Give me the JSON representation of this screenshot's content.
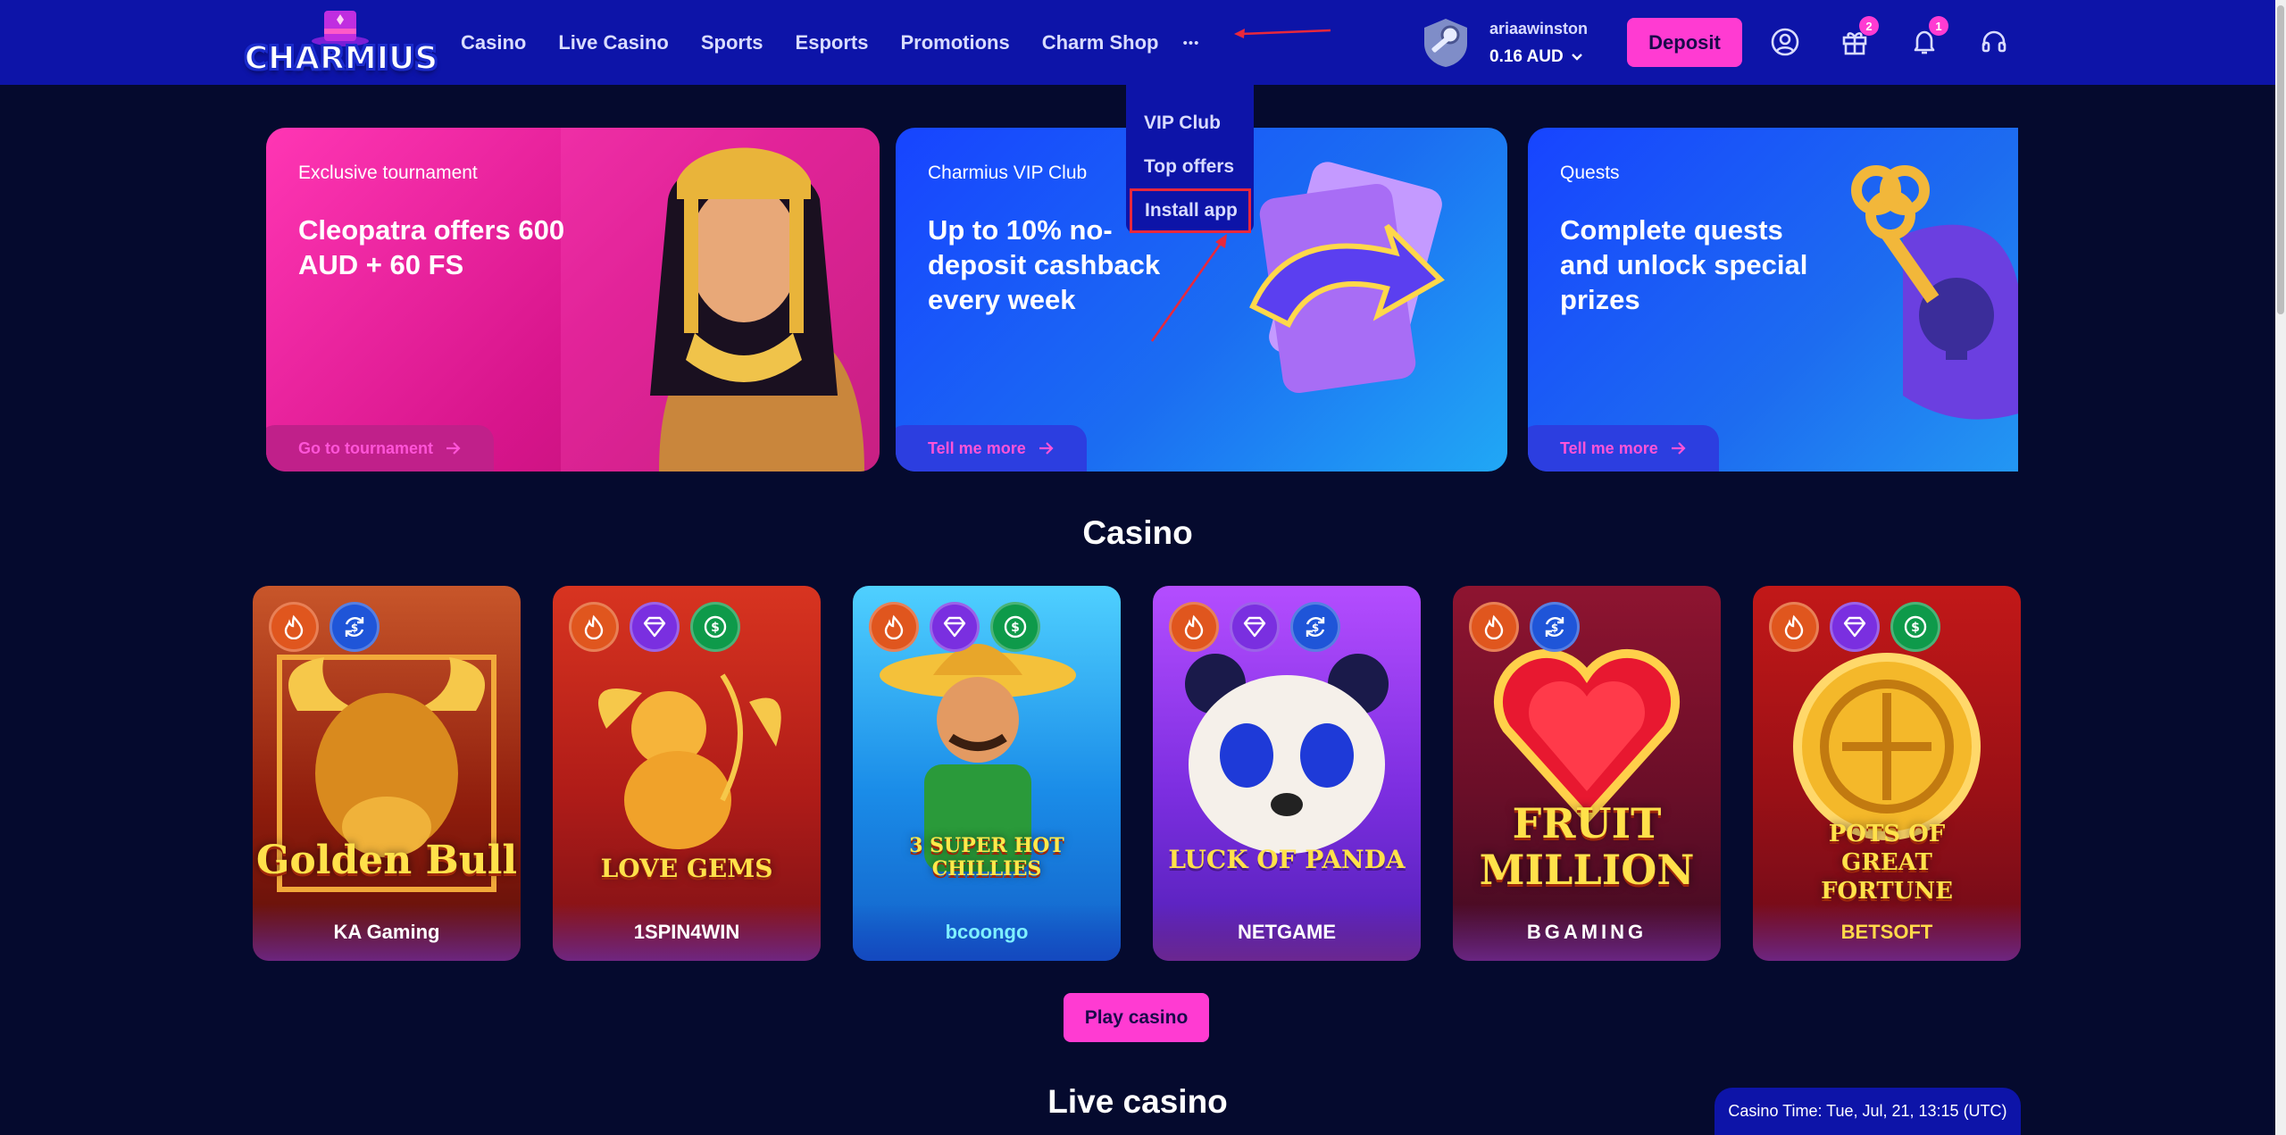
{
  "brand": {
    "logo_text": "CHARMIUS"
  },
  "nav": {
    "items": [
      "Casino",
      "Live Casino",
      "Sports",
      "Esports",
      "Promotions",
      "Charm Shop"
    ],
    "more_label": "•••"
  },
  "more_menu": {
    "items": [
      "VIP Club",
      "Top offers",
      "Install app"
    ],
    "highlighted": "Install app"
  },
  "user": {
    "username": "ariaawinston",
    "balance": "0.16 AUD"
  },
  "header_actions": {
    "deposit_label": "Deposit",
    "gift_count": "2",
    "notification_count": "1"
  },
  "promos": [
    {
      "subtitle": "Exclusive tournament",
      "title": "Cleopatra offers 600 AUD + 60 FS",
      "cta": "Go to tournament"
    },
    {
      "subtitle": "Charmius VIP Club",
      "title": "Up to 10% no-deposit cashback every week",
      "cta": "Tell me more"
    },
    {
      "subtitle": "Quests",
      "title": "Complete quests and unlock special prizes",
      "cta": "Tell me more"
    }
  ],
  "casino": {
    "title": "Casino",
    "games": [
      {
        "name": "Golden Bull",
        "provider": "KA Gaming",
        "chips": [
          "fire-icon",
          "refresh-dollar-icon"
        ]
      },
      {
        "name": "LOVE GEMS",
        "provider": "1SPIN4WIN",
        "chips": [
          "fire-icon",
          "diamond-icon",
          "dollar-icon"
        ]
      },
      {
        "name": "3 SUPER HOT CHILLIES",
        "provider": "bcoongo",
        "chips": [
          "fire-icon",
          "diamond-icon",
          "dollar-icon"
        ]
      },
      {
        "name": "LUCK OF PANDA",
        "provider": "NETGAME",
        "chips": [
          "fire-icon",
          "diamond-icon",
          "refresh-dollar-icon"
        ]
      },
      {
        "name": "FRUIT MILLION",
        "provider": "BGAMING",
        "chips": [
          "fire-icon",
          "refresh-dollar-icon"
        ]
      },
      {
        "name": "POTS OF GREAT FORTUNE",
        "provider": "BETSOFT",
        "chips": [
          "fire-icon",
          "diamond-icon",
          "dollar-icon"
        ]
      }
    ],
    "play_label": "Play casino"
  },
  "live_casino": {
    "title": "Live casino"
  },
  "casino_time": "Casino Time: Tue, Jul, 21, 13:15 (UTC)",
  "colors": {
    "header_bg": "#0d14a8",
    "accent": "#ff3bd2",
    "page_bg": "#050a2e",
    "annotation": "#e8283c"
  }
}
